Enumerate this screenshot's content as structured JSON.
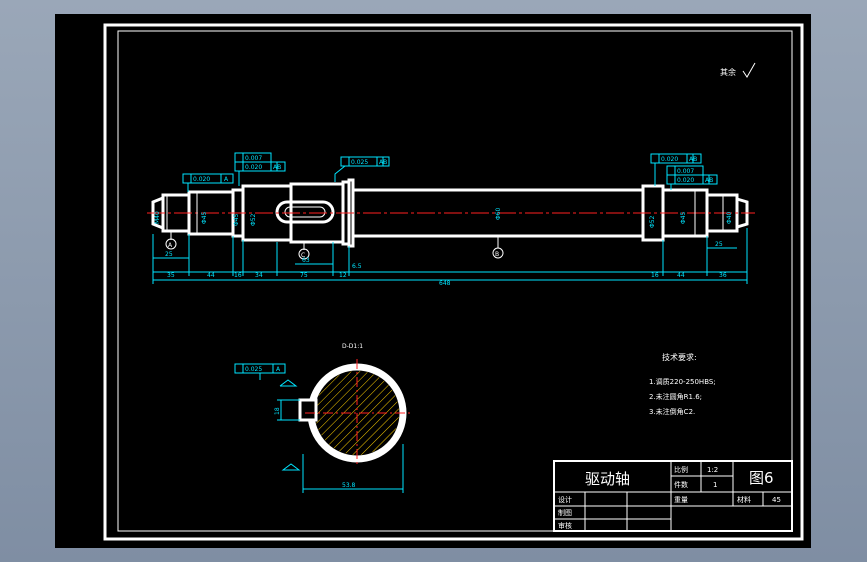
{
  "surface_finish_note": "其余",
  "drawing": {
    "tolerances": {
      "runout_left": "0.020",
      "runout_left_ref": "A",
      "cyl_left": "0.007",
      "runout_left2": "0.020",
      "runout_left2_ref": "AB",
      "runout_mid": "0.025",
      "runout_mid_ref": "AB",
      "runout_right": "0.020",
      "runout_right_ref": "AB",
      "cyl_right": "0.007",
      "runout_right2": "0.020",
      "runout_right2_ref": "AB",
      "parallel_key": "0.025",
      "parallel_ref": "A"
    },
    "datums": {
      "a": "A",
      "b": "B",
      "c": "C"
    },
    "diameters": {
      "d1": "M40",
      "d2": "Φ45",
      "d3": "Φ45",
      "d4": "Φ52",
      "d5": "Φ60",
      "d6": "Φ52",
      "d7": "Φ45",
      "d8": "Φ40"
    },
    "dims_bottom": [
      "35",
      "44",
      "16",
      "34",
      "75",
      "12",
      "16",
      "44",
      "36"
    ],
    "dim_total": "648",
    "dim_small": {
      "left_25": "25",
      "right_25": "25",
      "mid_63": "63",
      "mid_65": "6.5"
    },
    "section": {
      "title": "D-D1:1",
      "key_width": "18",
      "depth": "53.8"
    }
  },
  "tech_requirements": {
    "title": "技术要求:",
    "items": [
      "1.调质220-250HBS;",
      "2.未注圆角R1.6;",
      "3.未注倒角C2."
    ]
  },
  "title_block": {
    "part_name": "驱动轴",
    "scale_label": "比例",
    "scale_value": "1:2",
    "qty_label": "件数",
    "qty_value": "1",
    "weight_label": "重量",
    "material_label": "材料",
    "material_value": "45",
    "drawing_no": "图6",
    "designer_label": "设计",
    "drafter_label": "制图",
    "reviewer_label": "审核"
  }
}
